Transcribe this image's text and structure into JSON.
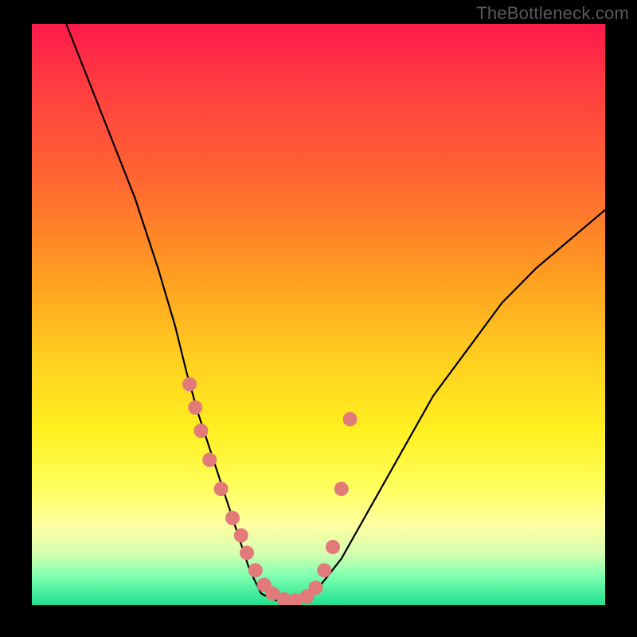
{
  "attribution": "TheBottleneck.com",
  "chart_data": {
    "type": "line",
    "title": "",
    "xlabel": "",
    "ylabel": "",
    "xlim": [
      0,
      100
    ],
    "ylim": [
      0,
      100
    ],
    "series": [
      {
        "name": "bottleneck-curve",
        "x": [
          6,
          10,
          14,
          18,
          22,
          25,
          27,
          29,
          31,
          33,
          35,
          36,
          37,
          38,
          39,
          40,
          42,
          44,
          46,
          48,
          50,
          54,
          58,
          62,
          66,
          70,
          76,
          82,
          88,
          94,
          100
        ],
        "y": [
          100,
          90,
          80,
          70,
          58,
          48,
          40,
          33,
          27,
          21,
          15,
          12,
          9,
          6,
          4,
          2,
          1,
          0.5,
          0.5,
          1,
          3,
          8,
          15,
          22,
          29,
          36,
          44,
          52,
          58,
          63,
          68
        ]
      }
    ],
    "markers": {
      "name": "highlighted-points",
      "x": [
        27.5,
        28.5,
        29.5,
        31,
        33,
        35,
        36.5,
        37.5,
        39,
        40.5,
        42,
        44,
        46,
        48,
        49.5,
        51,
        52.5,
        54,
        55.5
      ],
      "y": [
        38,
        34,
        30,
        25,
        20,
        15,
        12,
        9,
        6,
        3.5,
        2,
        1,
        0.8,
        1.5,
        3,
        6,
        10,
        20,
        32
      ]
    },
    "marker_color": "#e27a7a"
  }
}
